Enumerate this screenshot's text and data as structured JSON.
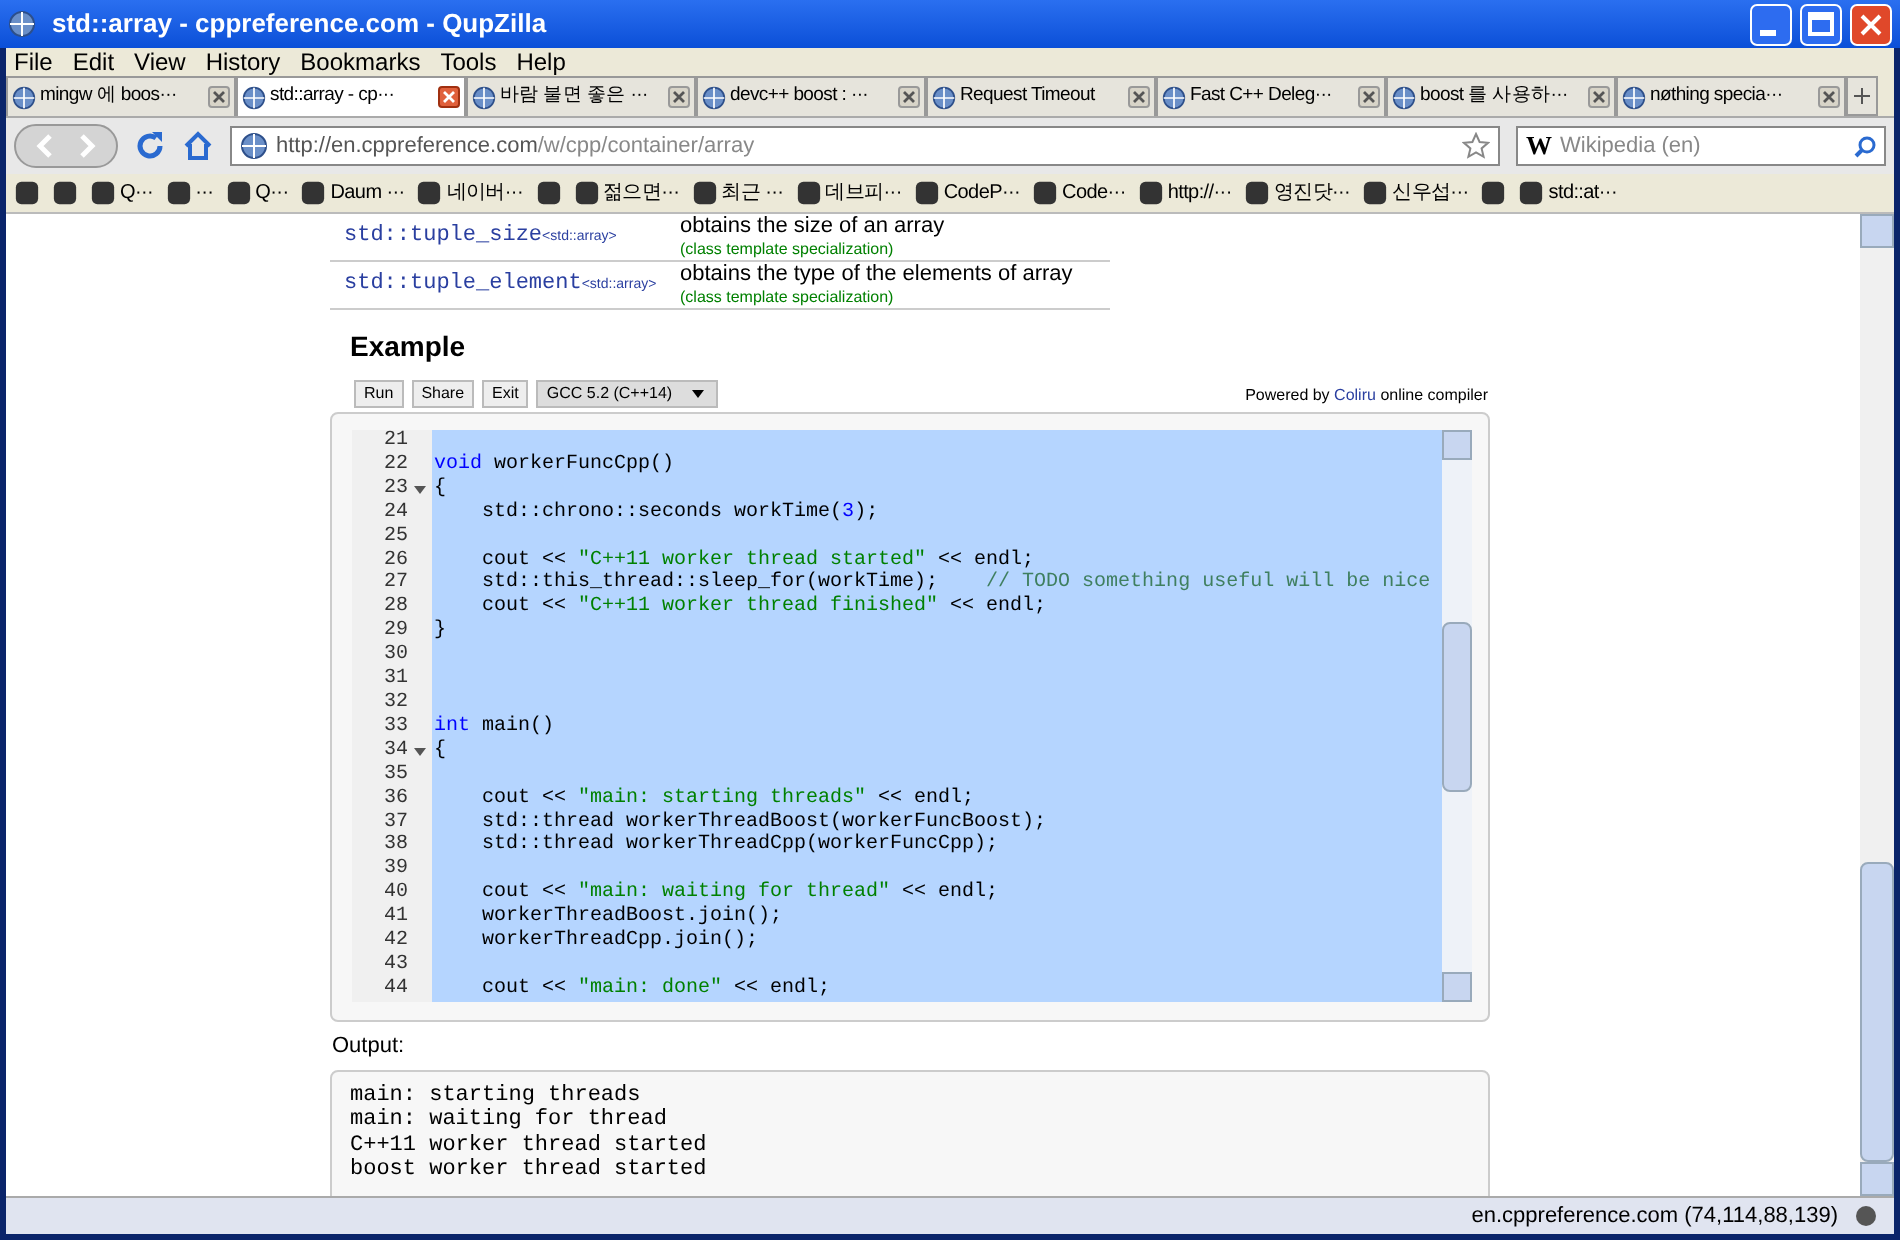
{
  "window": {
    "title": "std::array - cppreference.com - QupZilla"
  },
  "menu": [
    "File",
    "Edit",
    "View",
    "History",
    "Bookmarks",
    "Tools",
    "Help"
  ],
  "tabs": [
    {
      "label": "mingw 에 boos···",
      "selected": false
    },
    {
      "label": "std::array - cp···",
      "selected": true
    },
    {
      "label": "바람 불면 좋은 ···",
      "selected": false
    },
    {
      "label": "devc++ boost : ···",
      "selected": false
    },
    {
      "label": "Request Timeout",
      "selected": false
    },
    {
      "label": "Fast C++ Deleg···",
      "selected": false
    },
    {
      "label": "boost 를 사용하···",
      "selected": false
    },
    {
      "label": "nøthing specia···",
      "selected": false
    }
  ],
  "address": {
    "url_host": "http://en.cppreference.com",
    "url_path": "/w/cpp/container/array"
  },
  "search": {
    "engine": "W",
    "placeholder": "Wikipedia (en)"
  },
  "bookmarks": [
    {
      "kind": "icon"
    },
    {
      "kind": "icon"
    },
    {
      "kind": "link",
      "label": "Q···"
    },
    {
      "kind": "link",
      "label": "···"
    },
    {
      "kind": "link",
      "label": "Q···"
    },
    {
      "kind": "link",
      "label": "Daum ···"
    },
    {
      "kind": "link",
      "label": "네이버···"
    },
    {
      "kind": "icon"
    },
    {
      "kind": "link",
      "label": "젊으면···"
    },
    {
      "kind": "link",
      "label": "최근 ···"
    },
    {
      "kind": "link",
      "label": "데브피···"
    },
    {
      "kind": "link",
      "label": "CodeP···"
    },
    {
      "kind": "link",
      "label": "Code···"
    },
    {
      "kind": "link",
      "label": "http://···"
    },
    {
      "kind": "link",
      "label": "영진닷···"
    },
    {
      "kind": "link",
      "label": "신우섭···"
    },
    {
      "kind": "icon"
    },
    {
      "kind": "link",
      "label": "std::at···"
    }
  ],
  "members": [
    {
      "name": "std::tuple_size",
      "suffix": "<std::array>",
      "description": "obtains the size of an array",
      "note": "(class template specialization)"
    },
    {
      "name": "std::tuple_element",
      "suffix": "<std::array>",
      "description": "obtains the type of the elements of array",
      "note": "(class template specialization)"
    }
  ],
  "example": {
    "heading": "Example",
    "buttons": [
      "Run",
      "Share",
      "Exit"
    ],
    "compiler": "GCC 5.2 (C++14)",
    "powered_prefix": "Powered by",
    "powered_link": "Coliru",
    "powered_suffix": "online compiler",
    "code_lines": [
      {
        "number": "21",
        "foldable": false
      },
      {
        "number": "22",
        "foldable": false,
        "tokens": [
          {
            "kind": "keyword",
            "text": "void"
          },
          {
            "kind": "plain",
            "text": " workerFuncCpp()"
          }
        ]
      },
      {
        "number": "23",
        "foldable": true,
        "tokens": [
          {
            "kind": "plain",
            "text": "{"
          }
        ]
      },
      {
        "number": "24",
        "foldable": false,
        "tokens": [
          {
            "kind": "plain",
            "text": "    std::chrono::seconds workTime("
          },
          {
            "kind": "number",
            "text": "3"
          },
          {
            "kind": "plain",
            "text": ");"
          }
        ]
      },
      {
        "number": "25",
        "foldable": false
      },
      {
        "number": "26",
        "foldable": false,
        "tokens": [
          {
            "kind": "plain",
            "text": "    cout << "
          },
          {
            "kind": "string",
            "text": "\"C++11 worker thread started\""
          },
          {
            "kind": "plain",
            "text": " << endl;"
          }
        ]
      },
      {
        "number": "27",
        "foldable": false,
        "tokens": [
          {
            "kind": "plain",
            "text": "    std::this_thread::sleep_for(workTime);    "
          },
          {
            "kind": "comment",
            "text": "// TODO something useful will be nice"
          }
        ]
      },
      {
        "number": "28",
        "foldable": false,
        "tokens": [
          {
            "kind": "plain",
            "text": "    cout << "
          },
          {
            "kind": "string",
            "text": "\"C++11 worker thread finished\""
          },
          {
            "kind": "plain",
            "text": " << endl;"
          }
        ]
      },
      {
        "number": "29",
        "foldable": false,
        "tokens": [
          {
            "kind": "plain",
            "text": "}"
          }
        ]
      },
      {
        "number": "30",
        "foldable": false
      },
      {
        "number": "31",
        "foldable": false
      },
      {
        "number": "32",
        "foldable": false
      },
      {
        "number": "33",
        "foldable": false,
        "tokens": [
          {
            "kind": "keyword",
            "text": "int"
          },
          {
            "kind": "plain",
            "text": " main()"
          }
        ]
      },
      {
        "number": "34",
        "foldable": true,
        "tokens": [
          {
            "kind": "plain",
            "text": "{"
          }
        ]
      },
      {
        "number": "35",
        "foldable": false
      },
      {
        "number": "36",
        "foldable": false,
        "tokens": [
          {
            "kind": "plain",
            "text": "    cout << "
          },
          {
            "kind": "string",
            "text": "\"main: starting threads\""
          },
          {
            "kind": "plain",
            "text": " << endl;"
          }
        ]
      },
      {
        "number": "37",
        "foldable": false,
        "tokens": [
          {
            "kind": "plain",
            "text": "    std::thread workerThreadBoost(workerFuncBoost);"
          }
        ]
      },
      {
        "number": "38",
        "foldable": false,
        "tokens": [
          {
            "kind": "plain",
            "text": "    std::thread workerThreadCpp(workerFuncCpp);"
          }
        ]
      },
      {
        "number": "39",
        "foldable": false
      },
      {
        "number": "40",
        "foldable": false,
        "tokens": [
          {
            "kind": "plain",
            "text": "    cout << "
          },
          {
            "kind": "string",
            "text": "\"main: waiting for thread\""
          },
          {
            "kind": "plain",
            "text": " << endl;"
          }
        ]
      },
      {
        "number": "41",
        "foldable": false,
        "tokens": [
          {
            "kind": "plain",
            "text": "    workerThreadBoost.join();"
          }
        ]
      },
      {
        "number": "42",
        "foldable": false,
        "tokens": [
          {
            "kind": "plain",
            "text": "    workerThreadCpp.join();"
          }
        ]
      },
      {
        "number": "43",
        "foldable": false
      },
      {
        "number": "44",
        "foldable": false,
        "tokens": [
          {
            "kind": "plain",
            "text": "    cout << "
          },
          {
            "kind": "string",
            "text": "\"main: done\""
          },
          {
            "kind": "plain",
            "text": " << endl;"
          }
        ]
      }
    ],
    "output_label": "Output:",
    "output_lines": [
      "main: starting threads",
      "main: waiting for thread",
      "C++11 worker thread started",
      "boost worker thread started"
    ]
  },
  "status_bar": {
    "text": "en.cppreference.com (74,114,88,139)"
  }
}
